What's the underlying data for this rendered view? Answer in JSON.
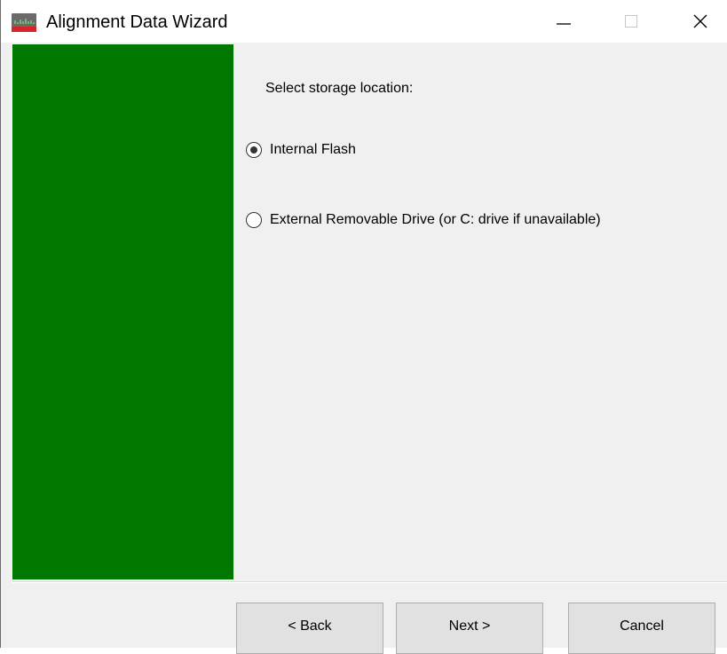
{
  "window": {
    "title": "Alignment Data Wizard",
    "minimize_glyph": "—",
    "close_glyph": "✕"
  },
  "panel": {
    "color": "#007800"
  },
  "content": {
    "prompt": "Select storage location:",
    "options": [
      {
        "label": "Internal Flash",
        "selected": true
      },
      {
        "label": "External Removable Drive (or C: drive if unavailable)",
        "selected": false
      }
    ]
  },
  "buttons": {
    "back": "< Back",
    "next": "Next >",
    "cancel": "Cancel"
  },
  "icons": {
    "app": "app-logo-icon",
    "minimize": "minimize-icon",
    "maximize": "maximize-icon",
    "close": "close-icon"
  }
}
